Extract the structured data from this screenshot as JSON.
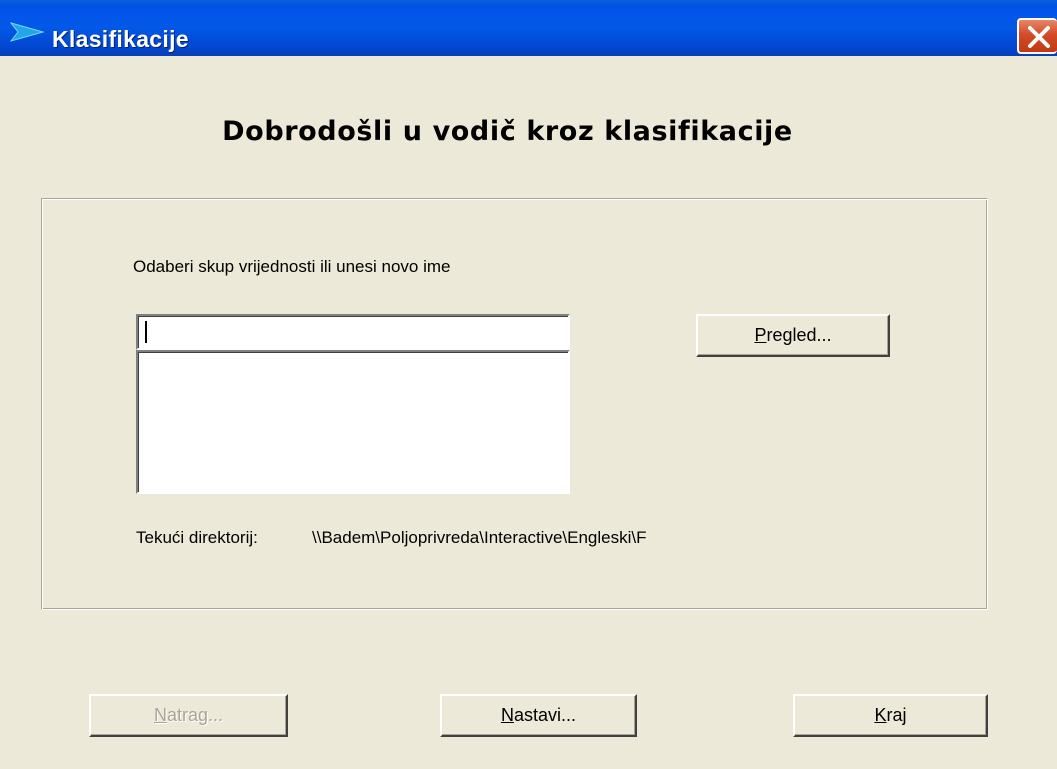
{
  "window": {
    "title": "Klasifikacije",
    "icon": "arrow-icon",
    "close_icon": "close-icon"
  },
  "heading": "Dobrodošli u vodič kroz klasifikacije",
  "form": {
    "prompt": "Odaberi skup vrijednosti ili unesi novo ime",
    "name_value": "",
    "browse_label_mnemonic": "P",
    "browse_label_rest": "regled...",
    "current_dir_label": "Tekući direktorij:",
    "current_dir_value": "\\\\Badem\\Poljoprivreda\\Interactive\\Engleski\\F"
  },
  "footer": {
    "back_mnemonic": "N",
    "back_rest": "atrag...",
    "next_mnemonic": "N",
    "next_rest": "astavi...",
    "end_mnemonic": "K",
    "end_rest": "raj"
  },
  "colors": {
    "window_bg": "#ECE9D8",
    "titlebar": "#0153E8",
    "close_button": "#D44B27",
    "disabled_text": "#A9A698"
  }
}
